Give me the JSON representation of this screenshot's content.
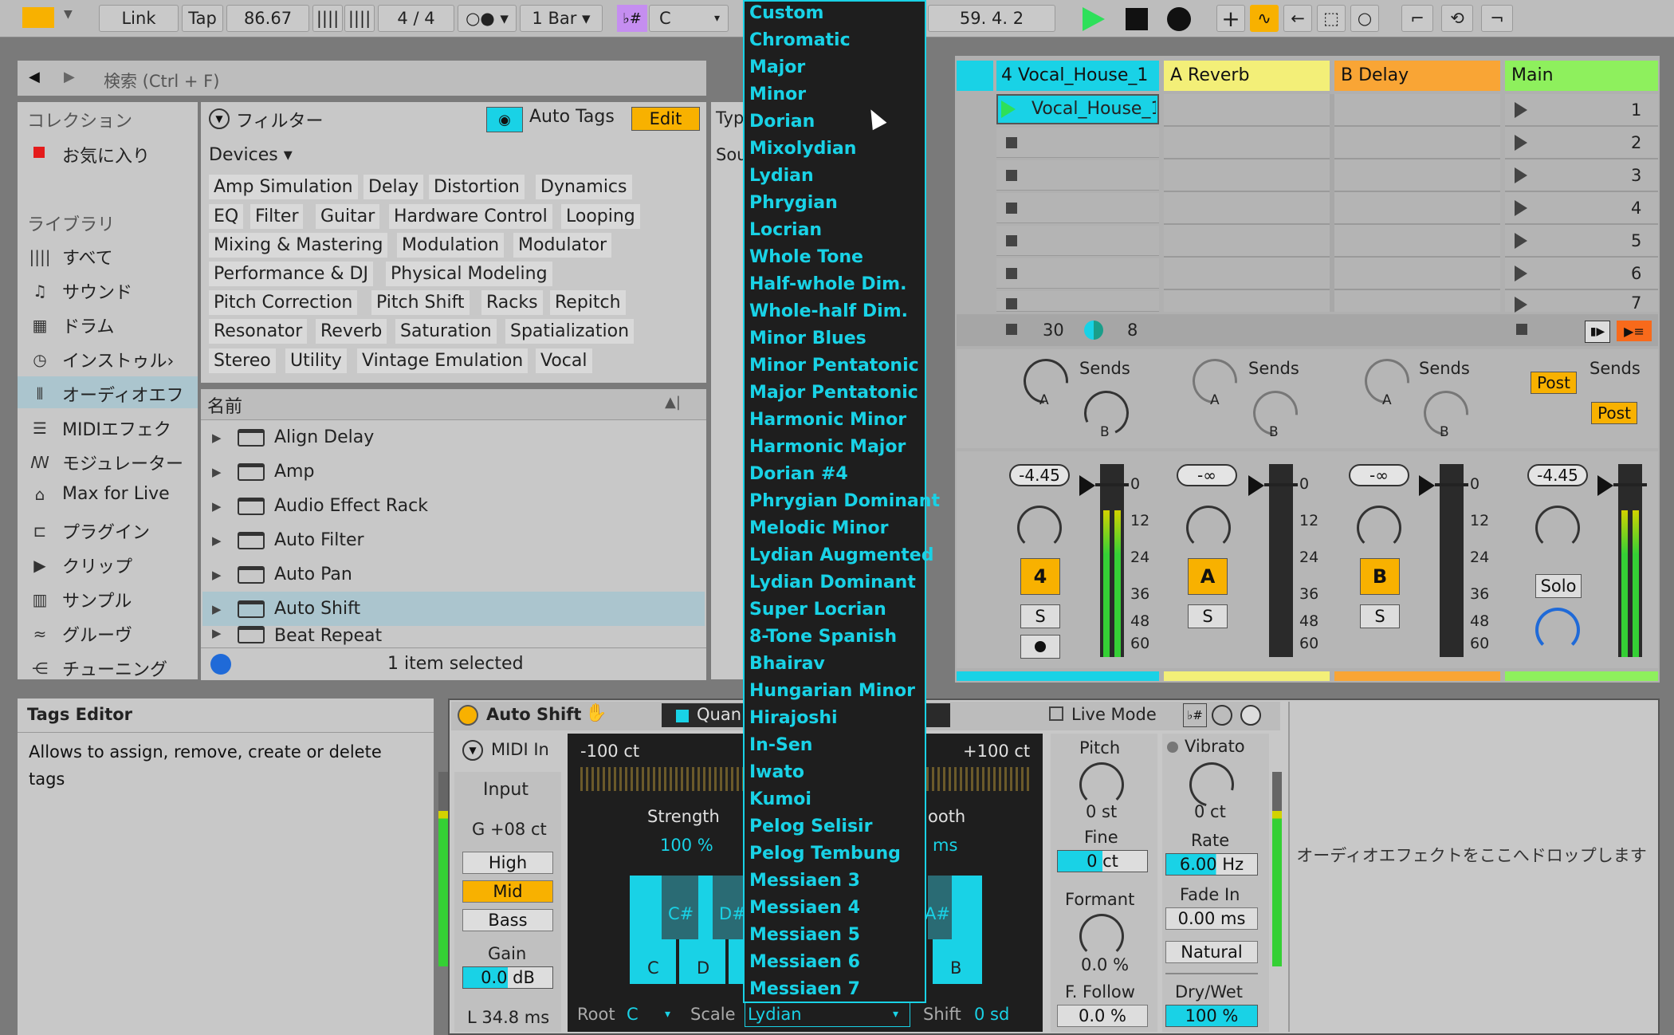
{
  "transport": {
    "link": "Link",
    "tap": "Tap",
    "tempo": "86.67",
    "signature": "4 / 4",
    "quantize": "1 Bar",
    "scale_key": "C",
    "position": "59.   4.   2"
  },
  "browser": {
    "search_placeholder": "検索 (Ctrl + F)",
    "collections_header": "コレクション",
    "favorites": "お気に入り",
    "library_header": "ライブラリ",
    "nav": [
      "すべて",
      "サウンド",
      "ドラム",
      "インストゥル›",
      "オーディオエフ",
      "MIDIエフェク",
      "モジュレーター",
      "Max for Live",
      "プラグイン",
      "クリップ",
      "サンプル",
      "グルーヴ",
      "チューニング"
    ],
    "filter_label": "フィルター",
    "auto_tags": "Auto Tags",
    "edit": "Edit",
    "devices_dropdown": "Devices ▾",
    "tags": [
      "Amp Simulation",
      "Delay",
      "Distortion",
      "Dynamics",
      "EQ",
      "Filter",
      "Guitar",
      "Hardware Control",
      "Looping",
      "Mixing & Mastering",
      "Modulation",
      "Modulator",
      "Performance & DJ",
      "Physical Modeling",
      "Pitch Correction",
      "Pitch Shift",
      "Racks",
      "Repitch",
      "Resonator",
      "Reverb",
      "Saturation",
      "Spatialization",
      "Stereo",
      "Utility",
      "Vintage Emulation",
      "Vocal"
    ],
    "name_header": "名前",
    "items": [
      "Align Delay",
      "Amp",
      "Audio Effect Rack",
      "Auto Filter",
      "Auto Pan",
      "Auto Shift",
      "Beat Repeat"
    ],
    "status": "1 item selected",
    "side_col_header": "Typ",
    "side_col_sub": "Sou"
  },
  "tags_editor": {
    "title": "Tags Editor",
    "description": "Allows to assign, remove, create or delete tags"
  },
  "scale_menu": [
    "Custom",
    "Chromatic",
    "Major",
    "Minor",
    "Dorian",
    "Mixolydian",
    "Lydian",
    "Phrygian",
    "Locrian",
    "Whole Tone",
    "Half-whole Dim.",
    "Whole-half Dim.",
    "Minor Blues",
    "Minor Pentatonic",
    "Major Pentatonic",
    "Harmonic Minor",
    "Harmonic Major",
    "Dorian #4",
    "Phrygian Dominant",
    "Melodic Minor",
    "Lydian Augmented",
    "Lydian Dominant",
    "Super Locrian",
    "8-Tone Spanish",
    "Bhairav",
    "Hungarian Minor",
    "Hirajoshi",
    "In-Sen",
    "Iwato",
    "Kumoi",
    "Pelog Selisir",
    "Pelog Tembung",
    "Messiaen 3",
    "Messiaen 4",
    "Messiaen 5",
    "Messiaen 6",
    "Messiaen 7"
  ],
  "mixer": {
    "tracks": [
      {
        "name": "4 Vocal_House_1",
        "color": "#19d2e6",
        "num": "4",
        "vol": "-4.45"
      },
      {
        "name": "A Reverb",
        "color": "#f3ef78",
        "num": "A",
        "vol": "-∞"
      },
      {
        "name": "B Delay",
        "color": "#f9a535",
        "num": "B",
        "vol": "-∞"
      },
      {
        "name": "Main",
        "color": "#8ef05d",
        "num": "",
        "vol": "-4.45"
      }
    ],
    "clip_name": "Vocal_House_1",
    "scene_numbers": [
      "1",
      "2",
      "3",
      "4",
      "5",
      "6",
      "7"
    ],
    "sends_label": "Sends",
    "post": "Post",
    "solo": "S",
    "solo_main": "Solo",
    "knob_a": "A",
    "knob_b": "B",
    "scale_ticks": [
      "0",
      "12",
      "24",
      "36",
      "48",
      "60"
    ],
    "stop_row": {
      "a": "30",
      "b": "8"
    }
  },
  "device": {
    "title": "Auto Shift",
    "quantize_tab": "Quan",
    "live_mode": "Live Mode",
    "midi_in": "MIDI In",
    "input": "Input",
    "input_note": "G +08 ct",
    "high": "High",
    "mid": "Mid",
    "bass": "Bass",
    "gain_label": "Gain",
    "gain_value": "0.0 dB",
    "latency": "L 34.8 ms",
    "range_low": "-100 ct",
    "range_high": "+100 ct",
    "strength_label": "Strength",
    "strength_value": "100 %",
    "smooth_label": "ooth",
    "smooth_value": "ms",
    "keys": [
      "C",
      "D",
      "B"
    ],
    "black_keys": [
      "C#",
      "D#",
      "A#"
    ],
    "root_label": "Root",
    "root_value": "C",
    "scale_label": "Scale",
    "scale_value": "Lydian",
    "shift_label": "Shift",
    "shift_value": "0 sd",
    "pitch_label": "Pitch",
    "pitch_value": "0 st",
    "fine_label": "Fine",
    "fine_value": "0 ct",
    "formant_label": "Formant",
    "formant_value": "0.0 %",
    "ffollow_label": "F. Follow",
    "ffollow_value": "0.0 %",
    "vibrato_label": "Vibrato",
    "vibrato_value": "0 ct",
    "rate_label": "Rate",
    "rate_value": "6.00 Hz",
    "fadein_label": "Fade In",
    "fadein_value": "0.00 ms",
    "natural": "Natural",
    "drywet_label": "Dry/Wet",
    "drywet_value": "100 %",
    "drop_hint": "オーディオエフェクトをここへドロップします"
  }
}
